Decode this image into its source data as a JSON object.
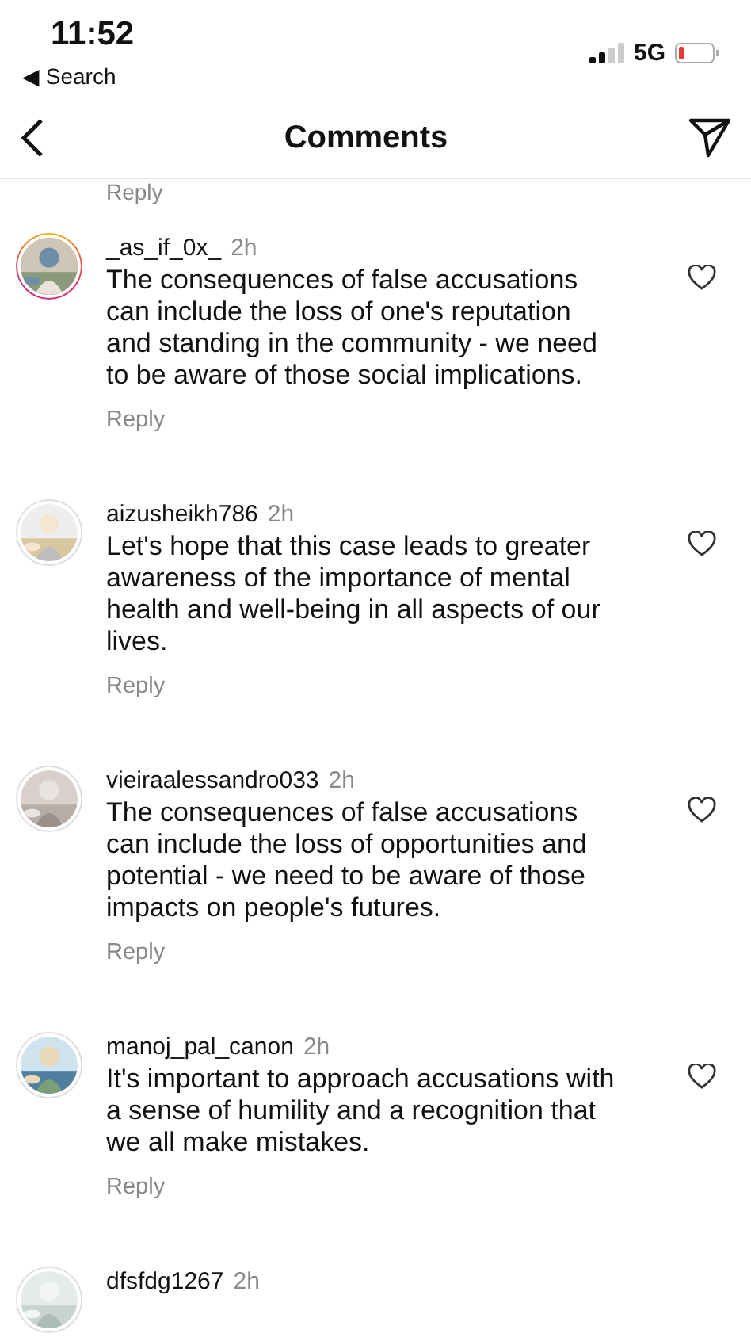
{
  "status_bar": {
    "time": "11:52",
    "back_link": "◀ Search",
    "network": "5G"
  },
  "nav": {
    "title": "Comments"
  },
  "previous_reply": "Reply",
  "comments": [
    {
      "username": "_as_if_0x_",
      "time": "2h",
      "story_ring": true,
      "text": "The consequences of false accusations can include the loss of one's reputation and standing in the community - we need to be aware of those social implications.",
      "reply": "Reply",
      "liked": false
    },
    {
      "username": "aizusheikh786",
      "time": "2h",
      "story_ring": false,
      "text": "Let's hope that this case leads to greater awareness of the importance of mental health and well-being in all aspects of our lives.",
      "reply": "Reply",
      "liked": false
    },
    {
      "username": "vieiraalessandro033",
      "time": "2h",
      "story_ring": false,
      "text": "The consequences of false accusations can include the loss of opportunities and potential - we need to be aware of those impacts on people's futures.",
      "reply": "Reply",
      "liked": false
    },
    {
      "username": "manoj_pal_canon",
      "time": "2h",
      "story_ring": false,
      "text": "It's important to approach accusations with a sense of humility and a recognition that we all make mistakes.",
      "reply": "Reply",
      "liked": false
    },
    {
      "username": "dfsfdg1267",
      "time": "2h",
      "story_ring": false
    }
  ]
}
